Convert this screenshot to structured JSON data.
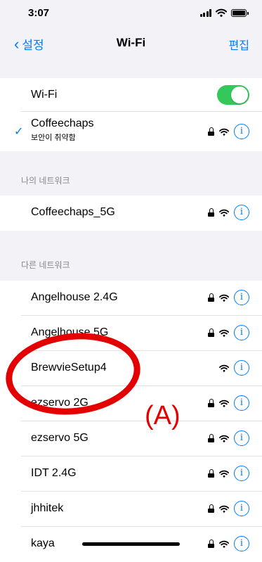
{
  "status_bar": {
    "time": "3:07"
  },
  "nav": {
    "back_label": "설정",
    "title": "Wi-Fi",
    "edit_label": "편집"
  },
  "wifi_toggle": {
    "label": "Wi-Fi",
    "on": true
  },
  "connected": {
    "name": "Coffeechaps",
    "subtitle": "보안이 취약함",
    "locked": true
  },
  "my_networks": {
    "header": "나의 네트워크",
    "items": [
      {
        "name": "Coffeechaps_5G",
        "locked": true
      }
    ]
  },
  "other_networks": {
    "header": "다른 네트워크",
    "items": [
      {
        "name": "Angelhouse 2.4G",
        "locked": true
      },
      {
        "name": "Angelhouse 5G",
        "locked": true
      },
      {
        "name": "BrewvieSetup4",
        "locked": false
      },
      {
        "name": "ezservo 2G",
        "locked": true
      },
      {
        "name": "ezservo 5G",
        "locked": true
      },
      {
        "name": "IDT 2.4G",
        "locked": true
      },
      {
        "name": "jhhitek",
        "locked": true
      },
      {
        "name": "kaya",
        "locked": true
      }
    ]
  },
  "annotation": {
    "label": "(A)",
    "color": "#e20000"
  },
  "colors": {
    "accent": "#007aff",
    "toggle_on": "#34c759"
  }
}
